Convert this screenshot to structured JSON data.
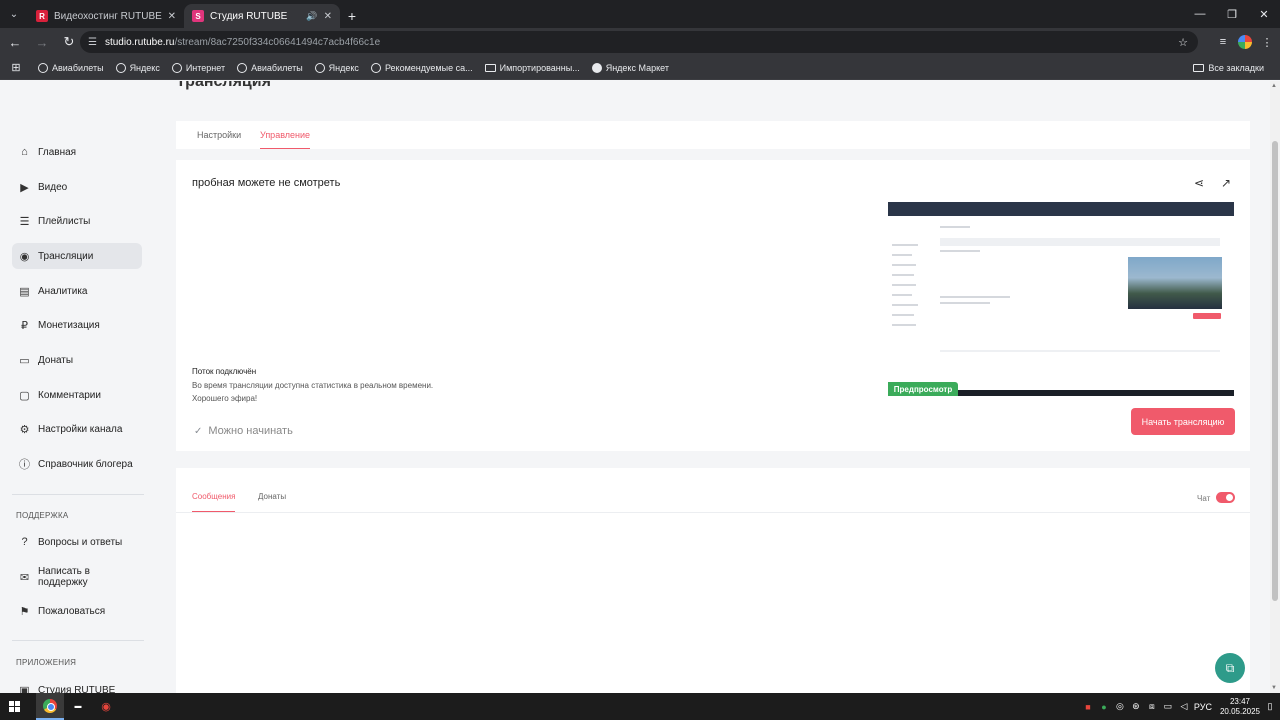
{
  "browser": {
    "tabs": [
      {
        "title": "Видеохостинг RUTUBE. Смотр",
        "favicon": "R",
        "active": false
      },
      {
        "title": "Студия RUTUBE",
        "favicon": "S",
        "active": true
      }
    ],
    "url_host": "studio.rutube.ru",
    "url_path": "/stream/8ac7250f334c06641494c7acb4f66c1e",
    "bookmarks": [
      "Авиабилеты",
      "Яндекс",
      "Интернет",
      "Авиабилеты",
      "Яндекс",
      "Рекомендуемые са...",
      "Импортированны...",
      "Яндекс Маркет"
    ],
    "all_bookmarks": "Все закладки"
  },
  "page": {
    "title": "Трансляция"
  },
  "sidebar": {
    "items": [
      {
        "label": "Главная",
        "icon": "home-icon"
      },
      {
        "label": "Видео",
        "icon": "video-icon"
      },
      {
        "label": "Плейлисты",
        "icon": "playlist-icon"
      },
      {
        "label": "Трансляции",
        "icon": "broadcast-icon"
      },
      {
        "label": "Аналитика",
        "icon": "chart-icon"
      },
      {
        "label": "Монетизация",
        "icon": "monetization-icon"
      },
      {
        "label": "Донаты",
        "icon": "donate-icon"
      },
      {
        "label": "Комментарии",
        "icon": "comments-icon"
      },
      {
        "label": "Настройки канала",
        "icon": "settings-icon"
      },
      {
        "label": "Справочник блогера",
        "icon": "info-icon"
      }
    ],
    "support_heading": "ПОДДЕРЖКА",
    "support_items": [
      {
        "label": "Вопросы и ответы",
        "icon": "question-icon"
      },
      {
        "label": "Написать в поддержку",
        "icon": "mail-icon"
      },
      {
        "label": "Пожаловаться",
        "icon": "flag-icon"
      }
    ],
    "apps_heading": "ПРИЛОЖЕНИЯ",
    "apps_items": [
      {
        "label": "Студия RUTUBE",
        "icon": "app-icon"
      }
    ]
  },
  "page_tabs": [
    {
      "label": "Настройки",
      "active": false
    },
    {
      "label": "Управление",
      "active": true
    }
  ],
  "stream": {
    "title": "пробная можете не смотреть",
    "status_heading": "Поток подключён",
    "status_lines": [
      "Во время трансляции доступна статистика в реальном времени.",
      "Хорошего эфира!"
    ],
    "ready_label": "Можно начинать",
    "preview_badge": "Предпросмотр",
    "start_button": "Начать трансляцию"
  },
  "chat": {
    "tabs": [
      {
        "label": "Сообщения",
        "active": true
      },
      {
        "label": "Донаты",
        "active": false
      }
    ],
    "toggle_label": "Чат",
    "toggle_on": true
  },
  "taskbar": {
    "language": "РУС",
    "time": "23:47",
    "date": "20.05.2025"
  },
  "colors": {
    "accent": "#f05a6b",
    "preview_badge": "#3bab5a",
    "help_fab": "#2e9b8a"
  }
}
